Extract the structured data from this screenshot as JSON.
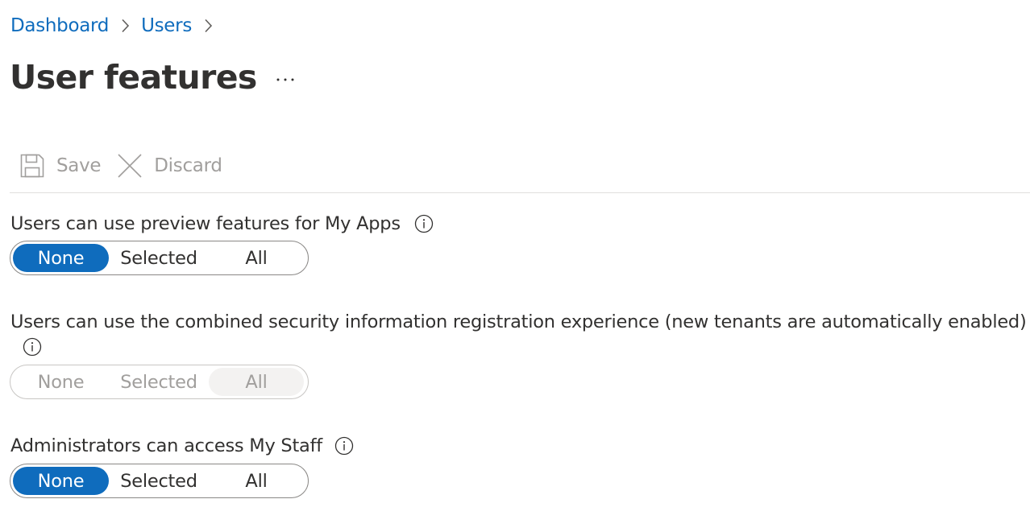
{
  "breadcrumb": {
    "items": [
      "Dashboard",
      "Users"
    ]
  },
  "page": {
    "title": "User features",
    "more_label": "···"
  },
  "toolbar": {
    "save_label": "Save",
    "discard_label": "Discard",
    "save_icon": "save-icon",
    "discard_icon": "close-icon"
  },
  "settings": [
    {
      "label": "Users can use preview features for My Apps",
      "options": [
        "None",
        "Selected",
        "All"
      ],
      "selected": "None",
      "enabled": true
    },
    {
      "label": "Users can use the combined security information registration experience (new tenants are automatically enabled)",
      "options": [
        "None",
        "Selected",
        "All"
      ],
      "selected": "All",
      "enabled": false
    },
    {
      "label": "Administrators can access My Staff",
      "options": [
        "None",
        "Selected",
        "All"
      ],
      "selected": "None",
      "enabled": true
    }
  ],
  "colors": {
    "accent": "#0f6cbd",
    "text": "#323130",
    "disabled_text": "#a19f9d"
  }
}
